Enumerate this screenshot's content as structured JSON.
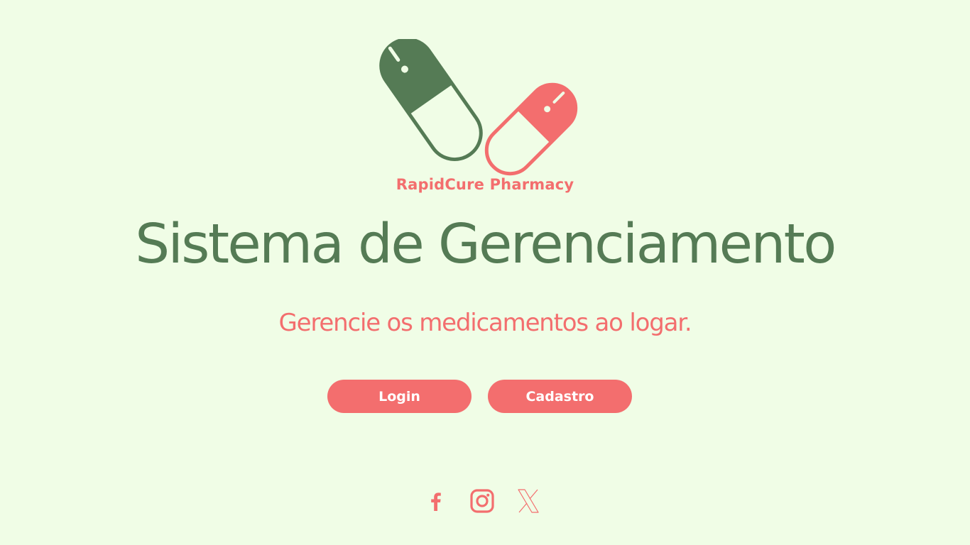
{
  "brand": {
    "name": "RapidCure Pharmacy"
  },
  "hero": {
    "title": "Sistema de Gerenciamento",
    "subtitle": "Gerencie os medicamentos ao logar."
  },
  "actions": {
    "login_label": "Login",
    "register_label": "Cadastro"
  },
  "social": {
    "icons": [
      "facebook-icon",
      "instagram-icon",
      "x-icon"
    ]
  },
  "colors": {
    "background": "#f0fde6",
    "primary_green": "#557b55",
    "accent_coral": "#f36e6e",
    "button_text": "#ffffff"
  }
}
